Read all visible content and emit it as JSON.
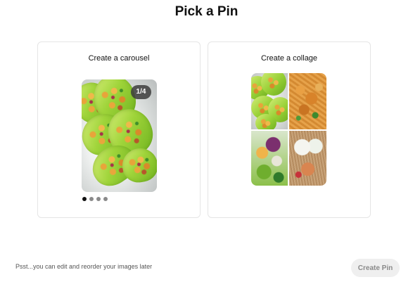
{
  "header": {
    "title": "Pick a Pin"
  },
  "options": [
    {
      "label": "Create a carousel",
      "badge": "1/4",
      "page_count": 4,
      "active_page": 1
    },
    {
      "label": "Create a collage"
    }
  ],
  "footer": {
    "hint": "Psst...you can edit and reorder your images later",
    "create_button_label": "Create Pin"
  },
  "colors": {
    "primary_text": "#111111",
    "button_bg": "#efefef",
    "button_text": "#8a8a8a",
    "card_border": "#e5e5e5"
  }
}
